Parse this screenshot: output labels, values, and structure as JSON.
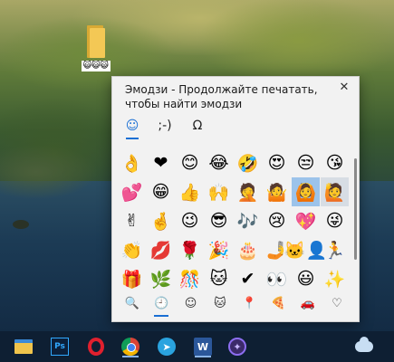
{
  "desktop": {
    "folder_label": "😺😺😺"
  },
  "emoji_panel": {
    "title": "Эмодзи - Продолжайте печатать, чтобы найти эмодзи",
    "close_glyph": "✕",
    "tabs": [
      {
        "label": "☺",
        "name": "emoji"
      },
      {
        "label": ";-)",
        "name": "kaomoji"
      },
      {
        "label": "Ω",
        "name": "symbols"
      }
    ],
    "emoji_rows": [
      [
        "👌",
        "❤",
        "😊",
        "😂",
        "🤣",
        "😍",
        "😒",
        "😘"
      ],
      [
        "💕",
        "😁",
        "👍",
        "🙌",
        "🤦",
        "🤷",
        "🙆",
        "🙋"
      ],
      [
        "✌",
        "🤞",
        "😉",
        "😎",
        "🎶",
        "😢",
        "💖",
        "😜"
      ],
      [
        "👏",
        "💋",
        "🌹",
        "🎉",
        "🎂",
        "🤳",
        "🐱‍👤",
        "🏃"
      ],
      [
        "🎁",
        "🌿",
        "🎊",
        "🐱",
        "✔",
        "👀",
        "😃",
        "✨"
      ]
    ],
    "categories": [
      {
        "label": "🔍",
        "name": "search"
      },
      {
        "label": "🕘",
        "name": "recent"
      },
      {
        "label": "☺",
        "name": "smileys"
      },
      {
        "label": "🐱",
        "name": "people"
      },
      {
        "label": "📍",
        "name": "places"
      },
      {
        "label": "🍕",
        "name": "food"
      },
      {
        "label": "🚗",
        "name": "transport"
      },
      {
        "label": "♡",
        "name": "hearts"
      }
    ]
  },
  "taskbar": {
    "items": [
      {
        "name": "file-explorer",
        "label": ""
      },
      {
        "name": "photoshop",
        "label": "Ps"
      },
      {
        "name": "opera",
        "label": ""
      },
      {
        "name": "chrome",
        "label": ""
      },
      {
        "name": "telegram",
        "label": "➤"
      },
      {
        "name": "word",
        "label": "W"
      },
      {
        "name": "app",
        "label": "✦"
      }
    ],
    "tray_icon": "onedrive-cloud"
  }
}
